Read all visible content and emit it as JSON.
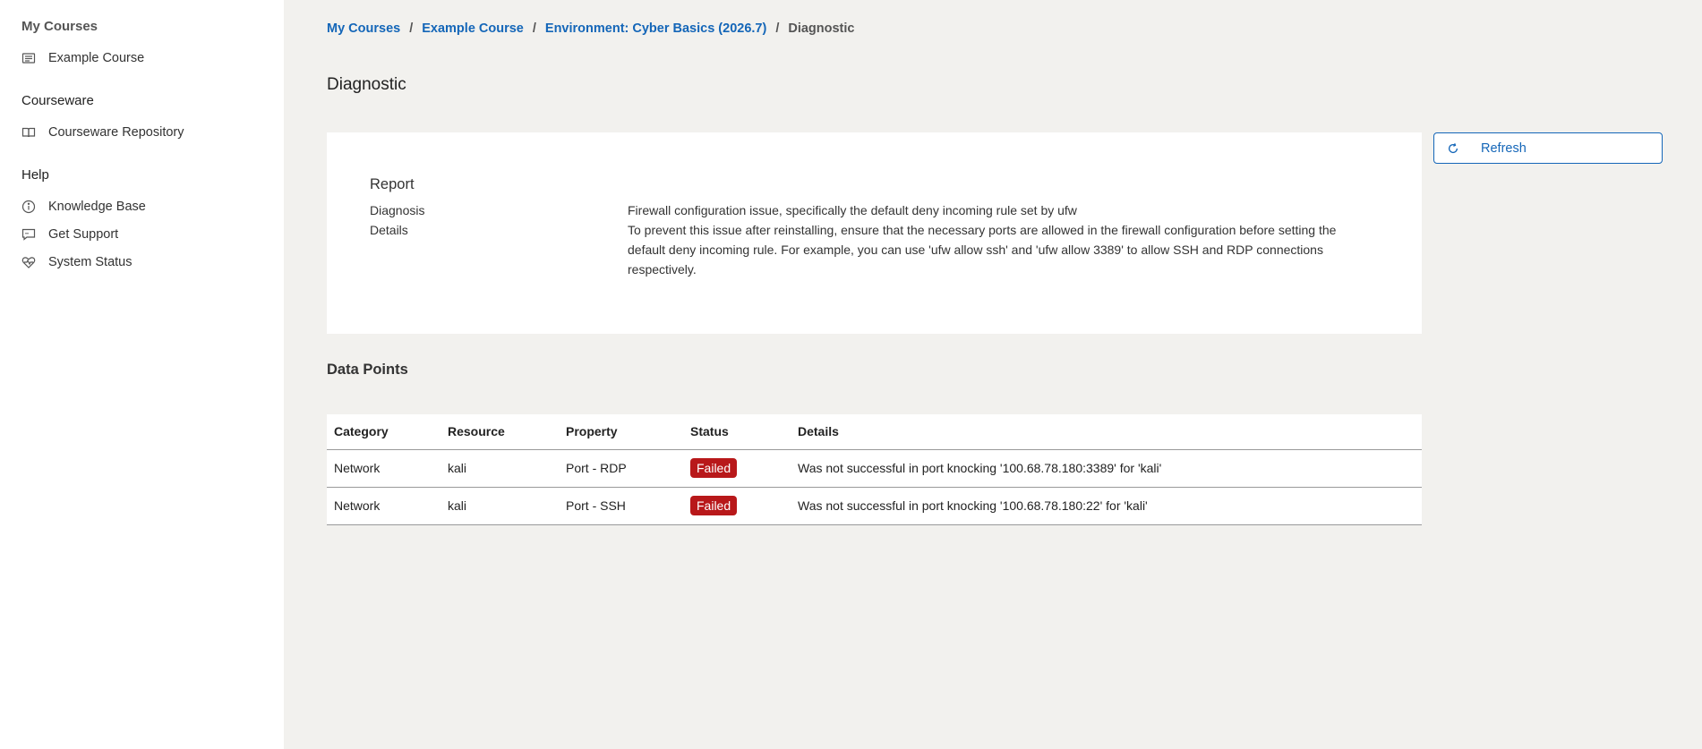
{
  "sidebar": {
    "sections": [
      {
        "heading": "My Courses",
        "items": [
          {
            "label": "Example Course",
            "icon": "course-list-icon"
          }
        ]
      },
      {
        "heading": "Courseware",
        "items": [
          {
            "label": "Courseware Repository",
            "icon": "book-icon"
          }
        ]
      },
      {
        "heading": "Help",
        "items": [
          {
            "label": "Knowledge Base",
            "icon": "info-icon"
          },
          {
            "label": "Get Support",
            "icon": "support-chat-icon"
          },
          {
            "label": "System Status",
            "icon": "heartbeat-icon"
          }
        ]
      }
    ]
  },
  "breadcrumb": {
    "items": [
      "My Courses",
      "Example Course",
      "Environment: Cyber Basics (2026.7)"
    ],
    "separator": "/",
    "current": "Diagnostic"
  },
  "page": {
    "title": "Diagnostic"
  },
  "report": {
    "title": "Report",
    "diagnosis_label": "Diagnosis",
    "diagnosis_value": "Firewall configuration issue, specifically the default deny incoming rule set by ufw",
    "details_label": "Details",
    "details_value": "To prevent this issue after reinstalling, ensure that the necessary ports are allowed in the firewall configuration before setting the default deny incoming rule. For example, you can use 'ufw allow ssh' and 'ufw allow 3389' to allow SSH and RDP connections respectively."
  },
  "toolbar": {
    "refresh_label": "Refresh",
    "refresh_icon": "refresh-icon"
  },
  "data_points": {
    "title": "Data Points",
    "columns": [
      "Category",
      "Resource",
      "Property",
      "Status",
      "Details"
    ],
    "rows": [
      {
        "category": "Network",
        "resource": "kali",
        "property": "Port - RDP",
        "status": "Failed",
        "details": "Was not successful in port knocking '100.68.78.180:3389' for 'kali'"
      },
      {
        "category": "Network",
        "resource": "kali",
        "property": "Port - SSH",
        "status": "Failed",
        "details": "Was not successful in port knocking '100.68.78.180:22' for 'kali'"
      }
    ]
  },
  "colors": {
    "accent": "#1466b8",
    "failed": "#b8181a",
    "background": "#f2f1ee"
  }
}
